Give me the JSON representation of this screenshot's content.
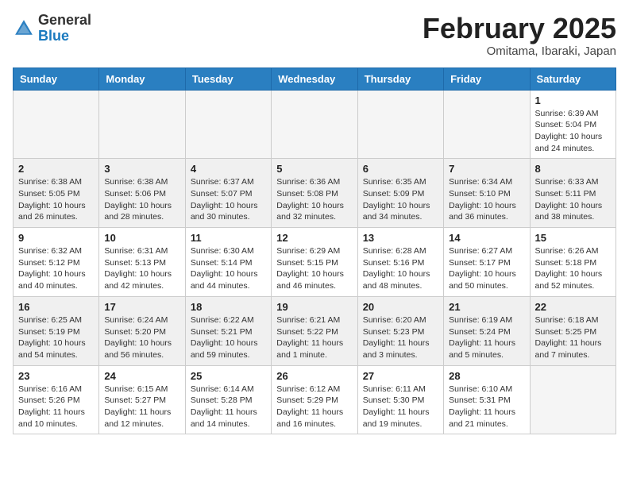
{
  "header": {
    "logo_general": "General",
    "logo_blue": "Blue",
    "month_title": "February 2025",
    "location": "Omitama, Ibaraki, Japan"
  },
  "days_of_week": [
    "Sunday",
    "Monday",
    "Tuesday",
    "Wednesday",
    "Thursday",
    "Friday",
    "Saturday"
  ],
  "weeks": [
    [
      {
        "day": "",
        "info": ""
      },
      {
        "day": "",
        "info": ""
      },
      {
        "day": "",
        "info": ""
      },
      {
        "day": "",
        "info": ""
      },
      {
        "day": "",
        "info": ""
      },
      {
        "day": "",
        "info": ""
      },
      {
        "day": "1",
        "info": "Sunrise: 6:39 AM\nSunset: 5:04 PM\nDaylight: 10 hours and 24 minutes."
      }
    ],
    [
      {
        "day": "2",
        "info": "Sunrise: 6:38 AM\nSunset: 5:05 PM\nDaylight: 10 hours and 26 minutes."
      },
      {
        "day": "3",
        "info": "Sunrise: 6:38 AM\nSunset: 5:06 PM\nDaylight: 10 hours and 28 minutes."
      },
      {
        "day": "4",
        "info": "Sunrise: 6:37 AM\nSunset: 5:07 PM\nDaylight: 10 hours and 30 minutes."
      },
      {
        "day": "5",
        "info": "Sunrise: 6:36 AM\nSunset: 5:08 PM\nDaylight: 10 hours and 32 minutes."
      },
      {
        "day": "6",
        "info": "Sunrise: 6:35 AM\nSunset: 5:09 PM\nDaylight: 10 hours and 34 minutes."
      },
      {
        "day": "7",
        "info": "Sunrise: 6:34 AM\nSunset: 5:10 PM\nDaylight: 10 hours and 36 minutes."
      },
      {
        "day": "8",
        "info": "Sunrise: 6:33 AM\nSunset: 5:11 PM\nDaylight: 10 hours and 38 minutes."
      }
    ],
    [
      {
        "day": "9",
        "info": "Sunrise: 6:32 AM\nSunset: 5:12 PM\nDaylight: 10 hours and 40 minutes."
      },
      {
        "day": "10",
        "info": "Sunrise: 6:31 AM\nSunset: 5:13 PM\nDaylight: 10 hours and 42 minutes."
      },
      {
        "day": "11",
        "info": "Sunrise: 6:30 AM\nSunset: 5:14 PM\nDaylight: 10 hours and 44 minutes."
      },
      {
        "day": "12",
        "info": "Sunrise: 6:29 AM\nSunset: 5:15 PM\nDaylight: 10 hours and 46 minutes."
      },
      {
        "day": "13",
        "info": "Sunrise: 6:28 AM\nSunset: 5:16 PM\nDaylight: 10 hours and 48 minutes."
      },
      {
        "day": "14",
        "info": "Sunrise: 6:27 AM\nSunset: 5:17 PM\nDaylight: 10 hours and 50 minutes."
      },
      {
        "day": "15",
        "info": "Sunrise: 6:26 AM\nSunset: 5:18 PM\nDaylight: 10 hours and 52 minutes."
      }
    ],
    [
      {
        "day": "16",
        "info": "Sunrise: 6:25 AM\nSunset: 5:19 PM\nDaylight: 10 hours and 54 minutes."
      },
      {
        "day": "17",
        "info": "Sunrise: 6:24 AM\nSunset: 5:20 PM\nDaylight: 10 hours and 56 minutes."
      },
      {
        "day": "18",
        "info": "Sunrise: 6:22 AM\nSunset: 5:21 PM\nDaylight: 10 hours and 59 minutes."
      },
      {
        "day": "19",
        "info": "Sunrise: 6:21 AM\nSunset: 5:22 PM\nDaylight: 11 hours and 1 minute."
      },
      {
        "day": "20",
        "info": "Sunrise: 6:20 AM\nSunset: 5:23 PM\nDaylight: 11 hours and 3 minutes."
      },
      {
        "day": "21",
        "info": "Sunrise: 6:19 AM\nSunset: 5:24 PM\nDaylight: 11 hours and 5 minutes."
      },
      {
        "day": "22",
        "info": "Sunrise: 6:18 AM\nSunset: 5:25 PM\nDaylight: 11 hours and 7 minutes."
      }
    ],
    [
      {
        "day": "23",
        "info": "Sunrise: 6:16 AM\nSunset: 5:26 PM\nDaylight: 11 hours and 10 minutes."
      },
      {
        "day": "24",
        "info": "Sunrise: 6:15 AM\nSunset: 5:27 PM\nDaylight: 11 hours and 12 minutes."
      },
      {
        "day": "25",
        "info": "Sunrise: 6:14 AM\nSunset: 5:28 PM\nDaylight: 11 hours and 14 minutes."
      },
      {
        "day": "26",
        "info": "Sunrise: 6:12 AM\nSunset: 5:29 PM\nDaylight: 11 hours and 16 minutes."
      },
      {
        "day": "27",
        "info": "Sunrise: 6:11 AM\nSunset: 5:30 PM\nDaylight: 11 hours and 19 minutes."
      },
      {
        "day": "28",
        "info": "Sunrise: 6:10 AM\nSunset: 5:31 PM\nDaylight: 11 hours and 21 minutes."
      },
      {
        "day": "",
        "info": ""
      }
    ]
  ]
}
